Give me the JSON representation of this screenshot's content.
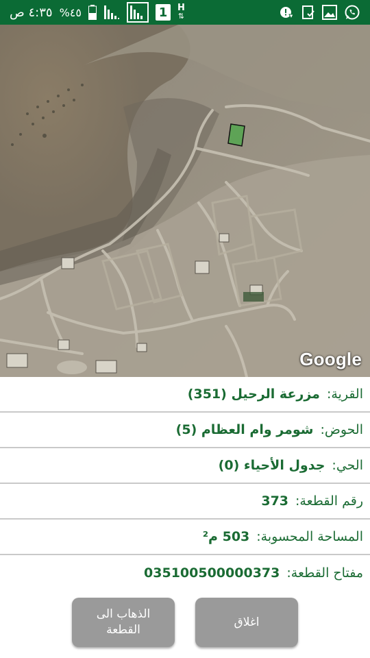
{
  "status_bar": {
    "time": "٤:٣٥ ص",
    "battery": "%٤٥",
    "sim_badge": "1",
    "network": "H",
    "icons": [
      "whatsapp-icon",
      "gallery-icon",
      "clipboard-icon",
      "warning-notification-icon",
      "signal-icon",
      "signal-icon",
      "battery-icon"
    ]
  },
  "map": {
    "logo": "Google"
  },
  "info": {
    "village": {
      "label": "القرية:",
      "value": "مزرعة الرحيل (351)"
    },
    "basin": {
      "label": "الحوض:",
      "value": "شومر وام العظام (5)"
    },
    "neighborhood": {
      "label": "الحي:",
      "value": "جدول الأحياء (0)"
    },
    "parcel_number": {
      "label": "رقم القطعة:",
      "value": "373"
    },
    "area": {
      "label": "المساحة المحسوبة:",
      "value": "503 م²"
    },
    "parcel_key": {
      "label": "مفتاح القطعة:",
      "value": "035100500000373"
    }
  },
  "buttons": {
    "goto_label": "الذهاب الى\nالقطعة",
    "close_label": "اغلاق"
  },
  "colors": {
    "status_bar": "#0b6b35",
    "text_green": "#1a6b33",
    "button_gray": "#9a9a9a",
    "parcel_fill": "#3fae3f"
  }
}
